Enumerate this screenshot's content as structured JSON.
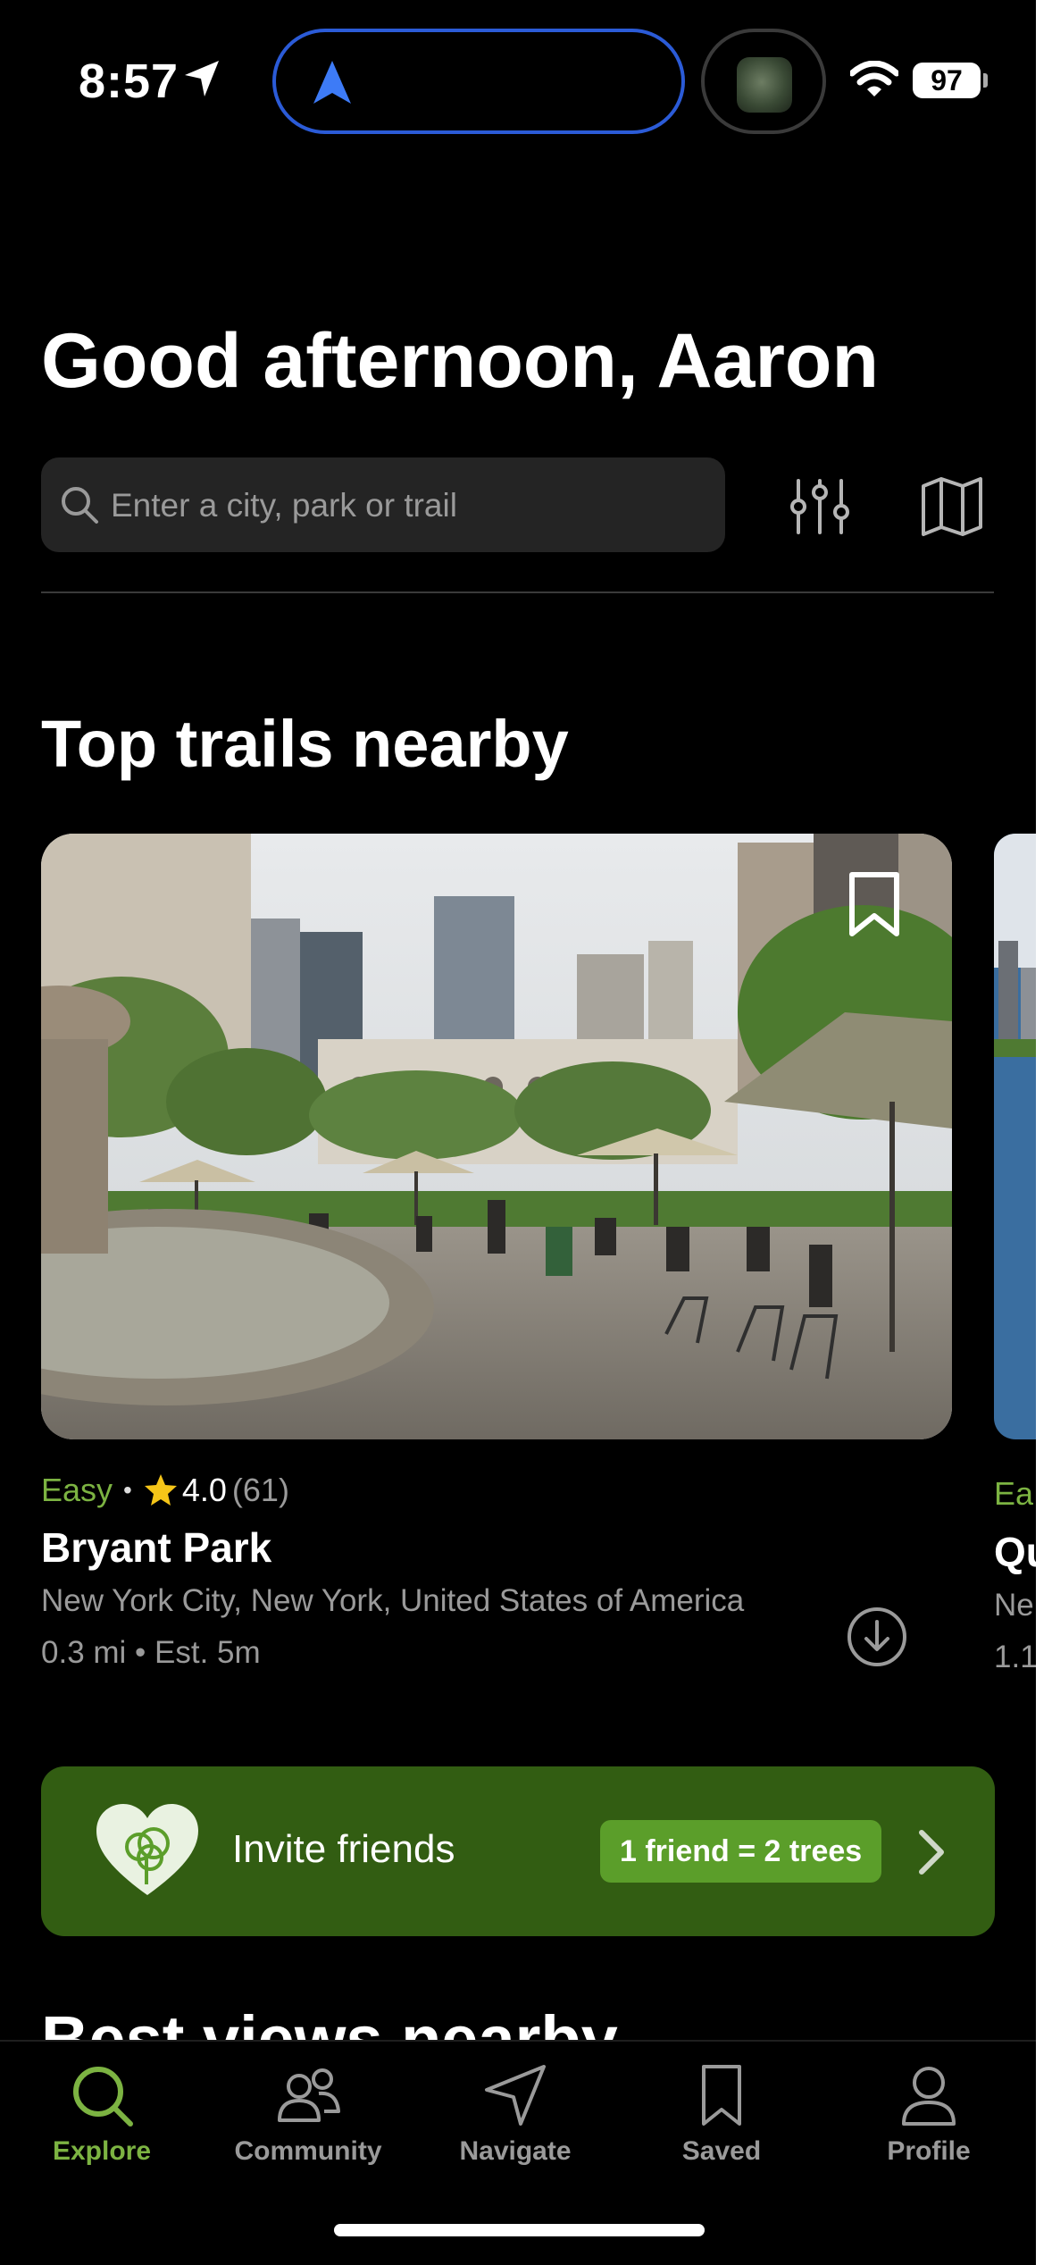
{
  "status_bar": {
    "time": "8:57",
    "battery": "97"
  },
  "greeting": "Good afternoon, Aaron",
  "search": {
    "placeholder": "Enter a city, park or trail"
  },
  "sections": {
    "top_trails": "Top trails nearby",
    "best_views": "Best views nearby"
  },
  "trails": [
    {
      "difficulty": "Easy",
      "rating": "4.0",
      "reviews": "(61)",
      "name": "Bryant Park",
      "location": "New York City, New York, United States of America",
      "distance": "0.3 mi",
      "estimate": "Est. 5m"
    },
    {
      "difficulty": "Ea",
      "name": "Qu",
      "location": "Ne",
      "distance": "1.1"
    }
  ],
  "invite": {
    "label": "Invite friends",
    "badge": "1 friend = 2 trees"
  },
  "tabs": [
    {
      "label": "Explore",
      "icon": "search-icon",
      "active": true
    },
    {
      "label": "Community",
      "icon": "people-icon",
      "active": false
    },
    {
      "label": "Navigate",
      "icon": "navigate-icon",
      "active": false
    },
    {
      "label": "Saved",
      "icon": "bookmark-icon",
      "active": false
    },
    {
      "label": "Profile",
      "icon": "person-icon",
      "active": false
    }
  ],
  "colors": {
    "accent": "#7cb342",
    "invite_bg": "#325d12",
    "badge_bg": "#5b9e2a",
    "island_border": "#2b5bd7",
    "background": "#000000"
  }
}
